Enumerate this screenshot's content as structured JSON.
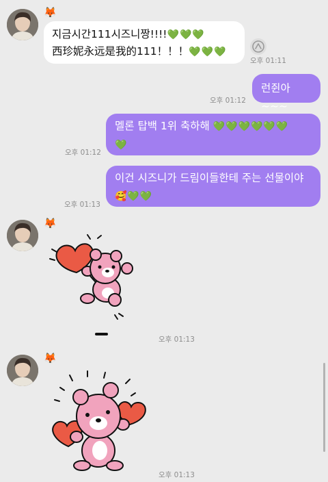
{
  "colors": {
    "background": "#ebebeb",
    "outgoing_bubble": "#a17ef0",
    "incoming_bubble": "#ffffff",
    "timestamp": "#8c8c8c"
  },
  "sender": {
    "name_emoji": "🦊"
  },
  "messages": [
    {
      "direction": "in",
      "line1": "지금시간111시즈니짱!!!!",
      "line1_hearts": "💚💚💚",
      "line2": "西珍妮永远是我的111！！！",
      "line2_hearts": "💚💚💚",
      "time": "오후 01:11"
    },
    {
      "direction": "out",
      "text": "런쥔아~~~",
      "time": "오후 01:12"
    },
    {
      "direction": "out",
      "text": "멜론 탑백 1위 축하해",
      "hearts_line1": "💚💚💚💚💚💚",
      "hearts_line2": "💚",
      "time": "오후 01:12"
    },
    {
      "direction": "out",
      "text": "이건 시즈니가 드림이들한테 주는 선물이야",
      "emoji_line2": "🥰💚💚",
      "time": "오후 01:13"
    },
    {
      "direction": "in",
      "type": "sticker",
      "sticker_icon": "bear-with-heart-sticker",
      "time": "오후 01:13"
    },
    {
      "direction": "in",
      "type": "sticker",
      "sticker_icon": "bear-with-two-hearts-sticker",
      "time": "오후 01:13"
    }
  ],
  "icons": {
    "share": "share-icon",
    "avatar": "profile-avatar"
  }
}
